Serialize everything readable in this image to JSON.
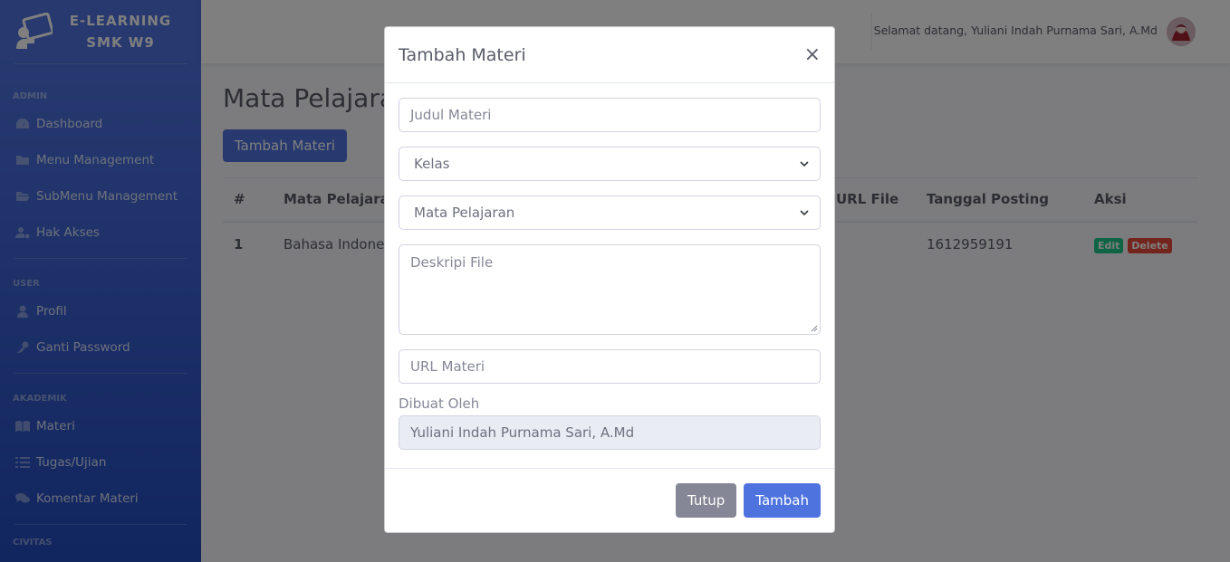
{
  "brand": {
    "line1": "E-LEARNING",
    "line2": "SMK W9"
  },
  "sidebar": {
    "sections": [
      {
        "heading": "ADMIN",
        "items": [
          {
            "label": "Dashboard",
            "icon": "dashboard-icon"
          },
          {
            "label": "Menu Management",
            "icon": "folder-icon"
          },
          {
            "label": "SubMenu Management",
            "icon": "folder-open-icon"
          },
          {
            "label": "Hak Akses",
            "icon": "user-cog-icon"
          }
        ]
      },
      {
        "heading": "USER",
        "items": [
          {
            "label": "Profil",
            "icon": "user-icon"
          },
          {
            "label": "Ganti Password",
            "icon": "key-icon"
          }
        ]
      },
      {
        "heading": "AKADEMIK",
        "items": [
          {
            "label": "Materi",
            "icon": "book-icon"
          },
          {
            "label": "Tugas/Ujian",
            "icon": "list-icon"
          },
          {
            "label": "Komentar Materi",
            "icon": "comments-icon"
          }
        ]
      },
      {
        "heading": "CIVITAS",
        "items": []
      }
    ]
  },
  "topbar": {
    "welcome": "Selamat datang, Yuliani Indah Purnama Sari, A.Md"
  },
  "main": {
    "title": "Mata Pelajaran",
    "add_button": "Tambah Materi",
    "table": {
      "headers": [
        "#",
        "Mata Pelajaran",
        "URL File",
        "Tanggal Posting",
        "Aksi"
      ],
      "rows": [
        {
          "no": "1",
          "subject": "Bahasa Indonesia",
          "url": "",
          "date": "1612959191",
          "edit": "Edit",
          "delete": "Delete"
        }
      ]
    }
  },
  "modal": {
    "title": "Tambah Materi",
    "close": "×",
    "judul_placeholder": "Judul Materi",
    "kelas_selected": "Kelas",
    "mapel_selected": "Mata Pelajaran",
    "deskripsi_placeholder": "Deskripi File",
    "url_placeholder": "URL Materi",
    "dibuat_label": "Dibuat Oleh",
    "dibuat_value": "Yuliani Indah Purnama Sari, A.Md",
    "btn_tutup": "Tutup",
    "btn_tambah": "Tambah"
  },
  "colors": {
    "primary": "#4e73df",
    "secondary": "#858796",
    "success": "#1cc88a",
    "danger": "#e74a3b"
  }
}
